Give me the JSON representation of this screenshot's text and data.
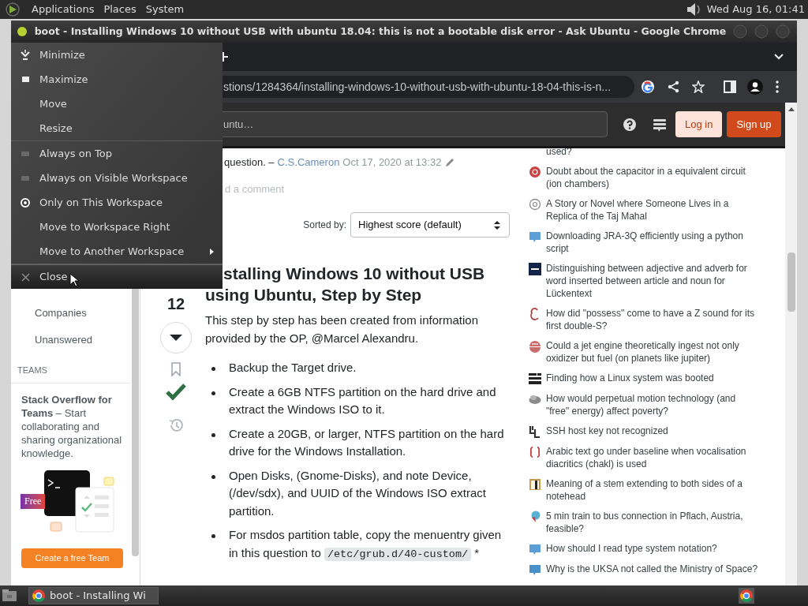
{
  "top_panel": {
    "menus": [
      "Applications",
      "Places",
      "System"
    ],
    "clock": "Wed Aug 16, 01:41"
  },
  "window": {
    "title": "boot - Installing Windows 10 without USB with ubuntu 18.04: this is not a bootable disk error - Ask Ubuntu - Google Chrome",
    "menu": {
      "groups": [
        [
          {
            "label": "Minimize",
            "kind": "minimize",
            "highlighted": false
          },
          {
            "label": "Maximize",
            "kind": "maximize",
            "highlighted": false
          },
          {
            "label": "Move",
            "kind": "plain",
            "highlighted": false
          },
          {
            "label": "Resize",
            "kind": "plain",
            "highlighted": false
          }
        ],
        [
          {
            "label": "Always on Top",
            "kind": "radio",
            "selected": false,
            "highlighted": false
          },
          {
            "label": "Always on Visible Workspace",
            "kind": "radio",
            "selected": false,
            "highlighted": false
          },
          {
            "label": "Only on This Workspace",
            "kind": "radio",
            "selected": true,
            "highlighted": false
          },
          {
            "label": "Move to Workspace Right",
            "kind": "plain",
            "highlighted": false
          },
          {
            "label": "Move to Another Workspace",
            "kind": "submenu",
            "highlighted": false
          }
        ],
        [
          {
            "label": "Close",
            "kind": "close",
            "highlighted": true
          }
        ]
      ]
    }
  },
  "browser": {
    "url": "stions/1284364/installing-windows-10-without-usb-with-ubuntu-18-04-this-is-n..."
  },
  "site_header": {
    "search_placeholder": "untu…",
    "login": "Log in",
    "signup": "Sign up"
  },
  "left_nav": {
    "items": [
      "Companies",
      "Unanswered"
    ],
    "section": "TEAMS",
    "promo": "**Stack Overflow for Teams** – Start collaborating and sharing organizational knowledge.",
    "badge": "Free",
    "button": "Create a free Team"
  },
  "comment": {
    "line2": "question. –",
    "author": "C.S.Cameron",
    "date": "Oct 17, 2020 at 13:32"
  },
  "add_comment": "d a comment",
  "sort": {
    "label": "Sorted by:",
    "value": "Highest score (default)"
  },
  "answer": {
    "score": "12",
    "accepted": true,
    "title_lines": [
      "stalling Windows 10 without USB",
      "using Ubuntu, Step by Step"
    ],
    "intro": "This step by step has been created from information provided by the OP, @Marcel Alexandru.",
    "steps": [
      {
        "text": "Backup the Target drive."
      },
      {
        "text": "Create a 6GB NTFS partition on the hard drive and extract the Windows ISO to it."
      },
      {
        "text": "Create a 20GB, or larger, NTFS partition on the hard drive for the Windows Installation."
      },
      {
        "text": "Open Disks, (Gnome-Disks), and note Device, (/dev/sdx), and UUID of the Windows ISO extract partition."
      },
      {
        "text": "For msdos partition table, copy the menuentry given in this question to ",
        "code": "/etc/grub.d/40-custom/",
        "after": " *"
      }
    ]
  },
  "hot_questions": [
    {
      "title": "used?"
    },
    {
      "title": "Doubt about the capacitor in a equivalent circuit (ion chambers)",
      "color": "#c94545"
    },
    {
      "title": "A Story or Novel where Someone Lives in a Replica of the Taj Mahal",
      "color": "#8c8c8c"
    },
    {
      "title": "Downloading JRA-3Q efficiently using a python script",
      "color": "#5b9fd6"
    },
    {
      "title": "Distinguishing between adjective and adverb for word inserted between article and noun for Lückentext",
      "color": "#14234a"
    },
    {
      "title": "How did \"possess\" come to have a Z sound for its first double-S?",
      "color": "#b04040"
    },
    {
      "title": "Could a jet engine theoretically ingest not only oxidizer but fuel (on planets like jupiter)",
      "color": "#c96b6b"
    },
    {
      "title": "Finding how a Linux system was booted",
      "color": "#222222"
    },
    {
      "title": "How would perpetual motion technology (and \"free\" energy) affect poverty?",
      "color": "#8a8a8a"
    },
    {
      "title": "SSH host key not recognized",
      "color": "#333333"
    },
    {
      "title": "Arabic text go under baseline when vocalisation diacritics (chakl) is used",
      "color": "#c04040"
    },
    {
      "title": "Meaning of a stem extending to both sides of a notehead",
      "color": "#c89a50"
    },
    {
      "title": "5 min train to bus connection in Pflach, Austria, feasible?",
      "color": "#5bb0d6"
    },
    {
      "title": "How should I read type system notation?",
      "color": "#5b9fd6"
    },
    {
      "title": "Why is the UKSA not called the Ministry of Space?",
      "color": "#4a90c8"
    }
  ],
  "taskbar": {
    "task": "boot - Installing Wi"
  }
}
